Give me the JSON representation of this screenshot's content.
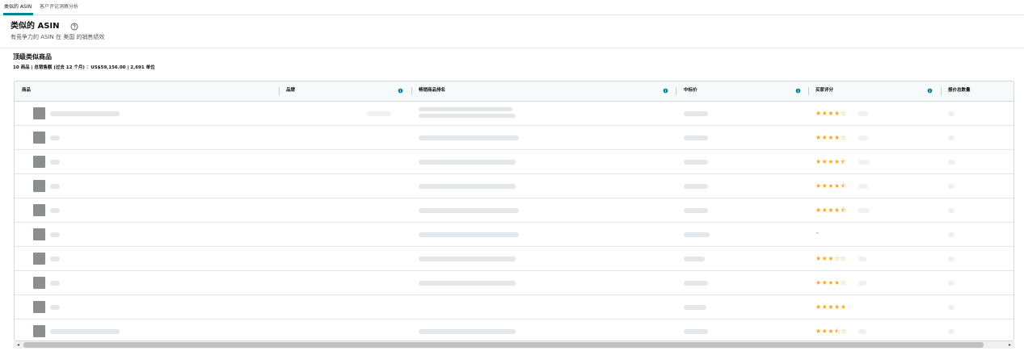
{
  "tabs": [
    {
      "label": "类似的 ASIN",
      "active": true
    },
    {
      "label": "客户评论洞察分析",
      "active": false
    }
  ],
  "header": {
    "title": "类似的 ASIN",
    "subtitle": "有竞争力的 ASIN 在 美国 的销售绩效",
    "help_icon": "question-circle-icon"
  },
  "top_products": {
    "title": "顶级类似商品",
    "summary": "10 商品 | 总销售额 (过去 12 个月) ：US$59,156.00 | 2,691 单位"
  },
  "table": {
    "columns": [
      {
        "label": "商品"
      },
      {
        "label": "品牌"
      },
      {
        "label": "畅销商品排名"
      },
      {
        "label": "中标价"
      },
      {
        "label": "买家评分"
      },
      {
        "label": "报价总数量"
      }
    ],
    "rows": [
      {
        "rating": "★★★★☆"
      },
      {
        "rating": "★★★★☆"
      },
      {
        "rating": "★★★★⯪"
      },
      {
        "rating": "★★★★⯪"
      },
      {
        "rating": "★★★★⯪"
      },
      {
        "rating": "-"
      },
      {
        "rating": "★★★☆☆"
      },
      {
        "rating": "★★★★☆"
      },
      {
        "rating": "★★★★★"
      },
      {
        "rating": "★★★⯪☆"
      }
    ]
  },
  "scrollbar": {
    "left_arrow": "◂",
    "right_arrow": "▸"
  },
  "colors": {
    "accent": "#008296",
    "star": "#ffa41c",
    "border": "#d5d9d9"
  }
}
